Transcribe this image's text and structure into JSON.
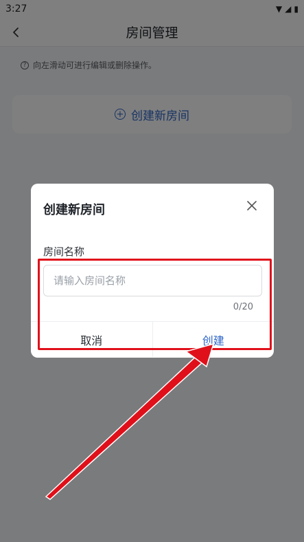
{
  "status_bar": {
    "time": "3:27",
    "icons": [
      "wifi-icon",
      "signal-icon",
      "battery-icon"
    ]
  },
  "app_bar": {
    "title": "房间管理",
    "back_icon": "chevron-left-icon"
  },
  "hint": {
    "text": "向左滑动可进行编辑或删除操作。",
    "icon": "info-circle-icon"
  },
  "create_card": {
    "label": "创建新房间",
    "icon": "plus-circle-icon"
  },
  "dialog": {
    "title": "创建新房间",
    "close_icon": "close-icon",
    "field_label": "房间名称",
    "input_value": "",
    "input_placeholder": "请输入房间名称",
    "char_count": "0/20",
    "cancel_label": "取消",
    "create_label": "创建"
  },
  "colors": {
    "accent": "#2f66c8",
    "highlight": "#e0101a",
    "overlay": "rgba(0,0,0,0.5)"
  }
}
